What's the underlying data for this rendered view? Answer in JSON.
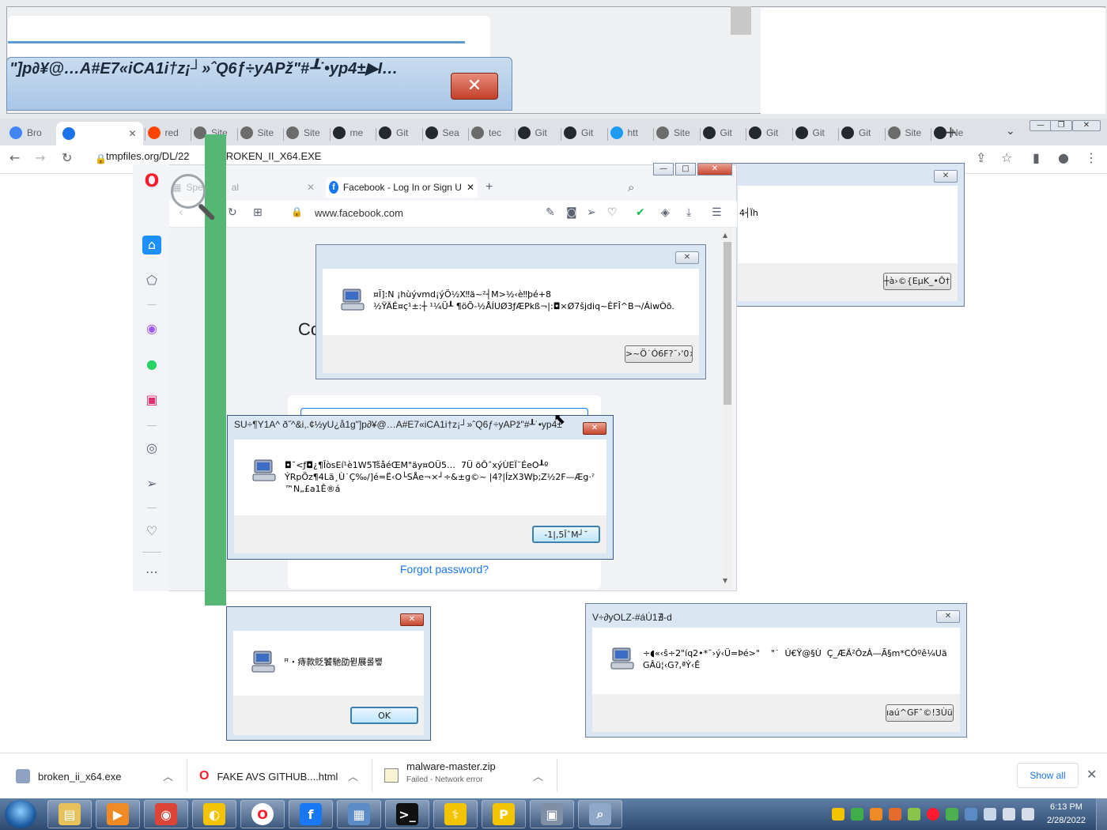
{
  "top_glitch": {
    "title_text": "\"]p∂¥@…A#E7«iCA1i†z¡┘»ˆQ6ƒ÷yAPž\"#┸˙•yp4±",
    "tail_text": "I…",
    "close_glyph": "✕"
  },
  "chrome": {
    "tabs": [
      {
        "label": "Bro",
        "color": "#4285f4"
      },
      {
        "label": "",
        "color": "#1a73e8"
      },
      {
        "label": "red",
        "color": "#ff4500"
      },
      {
        "label": "Site",
        "color": "#6b6b6b"
      },
      {
        "label": "Site",
        "color": "#6b6b6b"
      },
      {
        "label": "Site",
        "color": "#6b6b6b"
      },
      {
        "label": "me",
        "color": "#24292f"
      },
      {
        "label": "Git",
        "color": "#24292f"
      },
      {
        "label": "Sea",
        "color": "#24292f"
      },
      {
        "label": "tec",
        "color": "#6b6b6b"
      },
      {
        "label": "Git",
        "color": "#24292f"
      },
      {
        "label": "Git",
        "color": "#24292f"
      },
      {
        "label": "htt",
        "color": "#1d9bf0"
      },
      {
        "label": "Site",
        "color": "#6b6b6b"
      },
      {
        "label": "Git",
        "color": "#24292f"
      },
      {
        "label": "Git",
        "color": "#24292f"
      },
      {
        "label": "Git",
        "color": "#24292f"
      },
      {
        "label": "Git",
        "color": "#24292f"
      },
      {
        "label": "Site",
        "color": "#6b6b6b"
      },
      {
        "label": "Ne",
        "color": "#24292f"
      }
    ],
    "new_tab": "+",
    "tab_menu": "⌄",
    "address": "tmpfiles.org/DL/22",
    "address_tail": "/BROKEN_II_X64.EXE"
  },
  "opera": {
    "tab1": "Spe",
    "tab1_tail": "al",
    "tab2": "Facebook - Log In or Sign U",
    "url": "www.facebook.com",
    "heading_fragment": "Co",
    "forgot_password": "Forgot password?"
  },
  "dialogs": {
    "d1": {
      "line1": "¤Ĩ]:N ¡hùývmd¡ýÖ½X‼ä~²┤M>½‹è‼þé+8",
      "line2": "½ŸÄÉ¤ç¹±:┼ ¹¼Ü┸ ¶öÕ-½ÅÍUØ3ƒÆPkß¬|:◘×Ø7šjdiq~ÈFÎ^B¬/ÁiwÒõ.",
      "button": ">~Ö˙Ó6F?˘›'0×∂"
    },
    "d2": {
      "caption": "SU÷¶Y1A^ ð˝^&i,.¢½yU¿å1g\"]p∂¥@…A#E7«iCA1i†z¡┘»ˆQ6ƒ÷yAPž\"#┸˙•yp4±",
      "line1": "◘˘<ƒ◘¿¶ĪòsEí¹è1W5TšåéŒM\"äy¤OÜ5…  7Ü öÔˆxýÙEÏ˘ÉeO┸º",
      "line2": "ÝRpÖz¶4Lä¸Ù˙Ç‰/]é=Ë‹O└SÅe¬×┘÷&±g©~ |4?|ÍzX3Wþ;Z½2F—Æg·ˀ",
      "line3": "™N„£a1Ê®á",
      "button": "-1|,5ÎˆM┘˘"
    },
    "d3": {
      "line1": "ꟸ・痔款貶饕馳劭뮏展롤뵇",
      "button": "OK"
    },
    "d4": {
      "caption": "V÷∂yOLZ-#áÚ1∄-d",
      "line1": "÷◖«‹ŝ÷2\"íq2•*˘›ý‹Ü=Þé>\"    \"˙  Ú€Ÿ@§Ù  Ç_ÆÄ²ÔzÀ—Ã§m*CÓºê¼Uä",
      "line2": "GÂü¦‹G?,ªÝ‹Ê",
      "button": "ıaú^GFˆ©!3Ùüª"
    },
    "d5": {
      "fragment": "4┤Ïh",
      "button": "┼à›©{EµK_•Ô†Ĺ"
    },
    "close_glyph": "✕"
  },
  "downloads": {
    "items": [
      {
        "name": "broken_ii_x64.exe",
        "status": ""
      },
      {
        "name": "FAKE AVS GITHUB....html",
        "status": ""
      },
      {
        "name": "malware-master.zip",
        "status": "Failed - Network error"
      }
    ],
    "show_all": "Show all",
    "close": "✕"
  },
  "taskbar": {
    "time": "6:13 PM",
    "date": "2/28/2022",
    "apps": [
      {
        "icon": "explorer-icon",
        "color": "#e8c15a"
      },
      {
        "icon": "media-player-icon",
        "color": "#f08a24"
      },
      {
        "icon": "chrome-icon",
        "color": "#db4437"
      },
      {
        "icon": "pinball-icon",
        "color": "#f5c400"
      },
      {
        "icon": "opera-icon",
        "color": "#ff1b2d"
      },
      {
        "icon": "facebook-icon",
        "color": "#1877f2"
      },
      {
        "icon": "control-panel-icon",
        "color": "#5b8cc6"
      },
      {
        "icon": "cmd-icon",
        "color": "#111111"
      },
      {
        "icon": "stethoscope-icon",
        "color": "#f5c400"
      },
      {
        "icon": "p-icon",
        "color": "#f5c400"
      },
      {
        "icon": "broken-pc-icon",
        "color": "#7f8fa6"
      },
      {
        "icon": "search-computer-icon",
        "color": "#8fa8c8"
      }
    ]
  }
}
